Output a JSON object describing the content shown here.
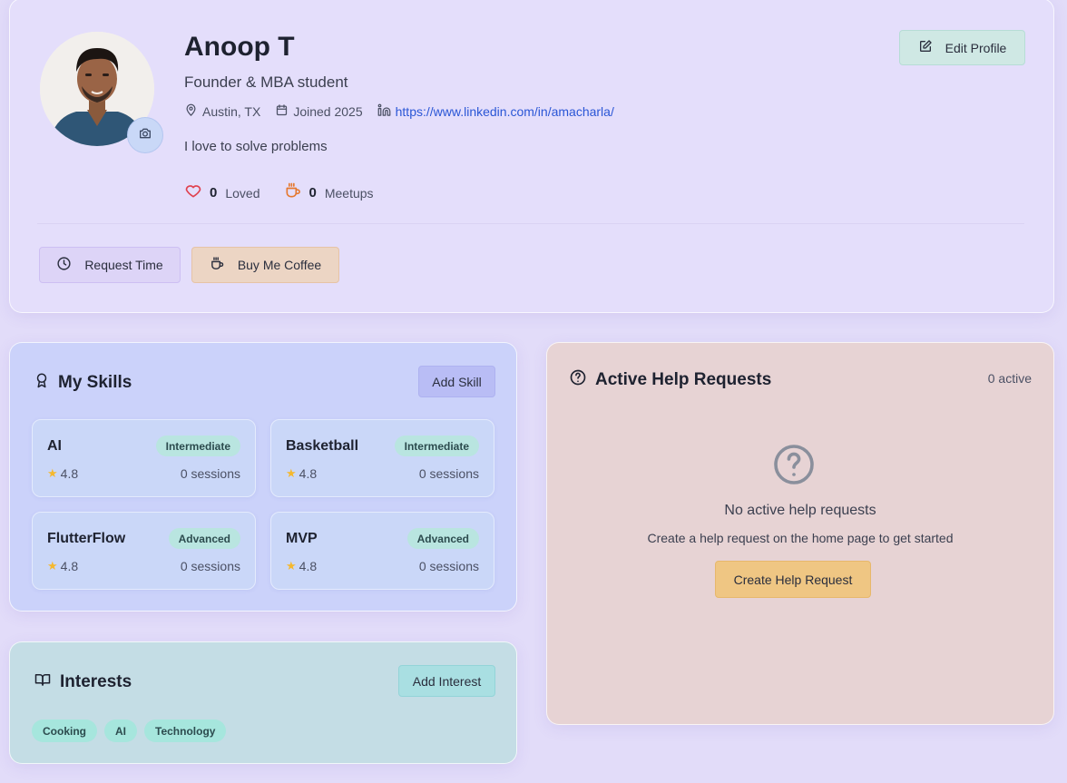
{
  "profile": {
    "name": "Anoop T",
    "tagline": "Founder & MBA student",
    "location": "Austin, TX",
    "joined": "Joined 2025",
    "linkedin": "https://www.linkedin.com/in/amacharla/",
    "bio": "I love to solve problems",
    "loved_count": "0",
    "loved_label": "Loved",
    "meetups_count": "0",
    "meetups_label": "Meetups",
    "edit_label": "Edit Profile",
    "request_time_label": "Request Time",
    "buy_coffee_label": "Buy Me Coffee"
  },
  "skills": {
    "title": "My Skills",
    "add_label": "Add Skill",
    "items": [
      {
        "name": "AI",
        "level": "Intermediate",
        "rating": "4.8",
        "sessions": "0 sessions"
      },
      {
        "name": "Basketball",
        "level": "Intermediate",
        "rating": "4.8",
        "sessions": "0 sessions"
      },
      {
        "name": "FlutterFlow",
        "level": "Advanced",
        "rating": "4.8",
        "sessions": "0 sessions"
      },
      {
        "name": "MVP",
        "level": "Advanced",
        "rating": "4.8",
        "sessions": "0 sessions"
      }
    ]
  },
  "interests": {
    "title": "Interests",
    "add_label": "Add Interest",
    "tags": [
      "Cooking",
      "AI",
      "Technology"
    ]
  },
  "help_requests": {
    "title": "Active Help Requests",
    "active_count": "0 active",
    "empty_title": "No active help requests",
    "empty_sub": "Create a help request on the home page to get started",
    "create_label": "Create Help Request"
  },
  "colors": {
    "page_bg": "#e2dcf9",
    "link": "#2a56d6",
    "heart": "#e0414f",
    "coffee": "#e5782f",
    "star": "#f5b82e"
  }
}
